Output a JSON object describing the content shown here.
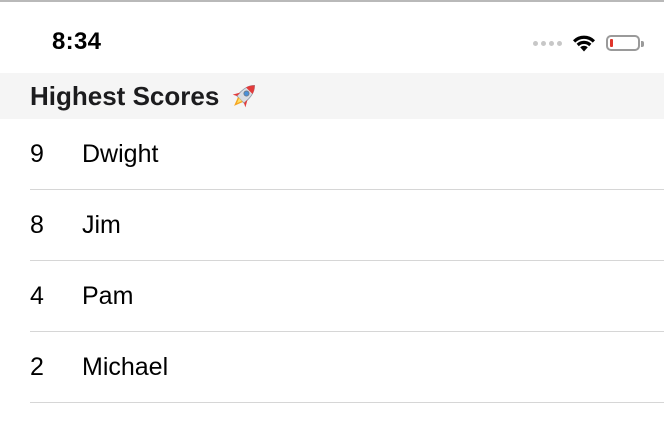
{
  "status_bar": {
    "time": "8:34",
    "signal_icon": "signal-dots-icon",
    "wifi_icon": "wifi-icon",
    "battery_icon": "battery-icon",
    "battery_level": 0.1,
    "battery_color": "#e0342a"
  },
  "header": {
    "title": "Highest Scores",
    "emoji_icon": "rocket-icon"
  },
  "scores": [
    {
      "score": "9",
      "name": "Dwight"
    },
    {
      "score": "8",
      "name": "Jim"
    },
    {
      "score": "4",
      "name": "Pam"
    },
    {
      "score": "2",
      "name": "Michael"
    }
  ],
  "colors": {
    "header_background": "#f5f5f5",
    "separator": "#d6d6d6"
  }
}
